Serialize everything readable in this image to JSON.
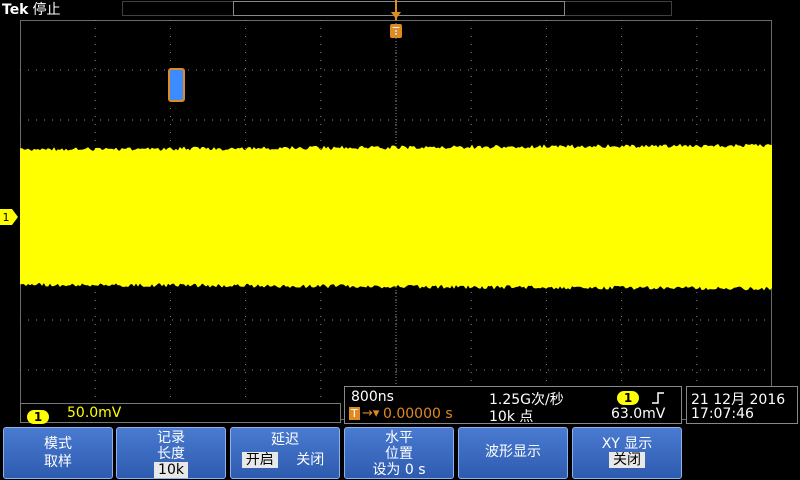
{
  "header": {
    "brand": "Tek",
    "status": "停止"
  },
  "trigger_marker": "T",
  "channel": {
    "number": "1",
    "scale": "50.0mV",
    "color": "#ffff00"
  },
  "horizontal": {
    "timebase": "800ns",
    "sample_rate": "1.25G次/秒",
    "trigger_icon": "T",
    "position": "0.00000 s",
    "record_points": "10k 点",
    "trig_channel": "1",
    "trig_slope_icon": "rising-edge-icon",
    "trig_level": "63.0mV"
  },
  "datetime": {
    "date": "21 12月 2016",
    "time": "17:07:46"
  },
  "menu": {
    "mode": {
      "title": "模式",
      "value": "取样"
    },
    "record": {
      "title1": "记录",
      "title2": "长度",
      "value": "10k"
    },
    "delay": {
      "title": "延迟",
      "on": "开启",
      "off": "关闭"
    },
    "horizontal": {
      "title1": "水平",
      "title2": "位置",
      "value": "设为 0 s"
    },
    "waveform": {
      "title": "波形显示"
    },
    "xy": {
      "title": "XY 显示",
      "value": "关闭"
    }
  },
  "colors": {
    "trace": "#ffff00",
    "accent": "#e08a22",
    "menu": "#3a6bc4"
  }
}
